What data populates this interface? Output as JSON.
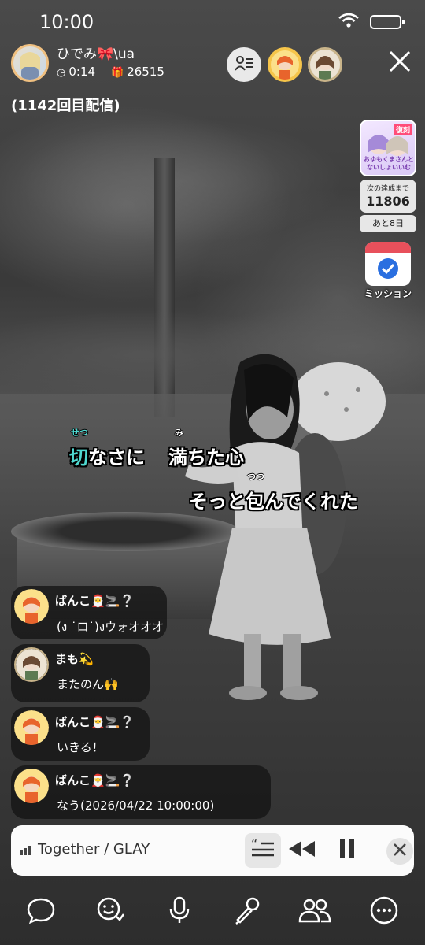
{
  "status_bar": {
    "time": "10:00"
  },
  "header": {
    "host_name": "ひでみ🎀\\ua",
    "elapsed": "0:14",
    "gifts": "26515",
    "stream_title": "(1142回目配信)"
  },
  "side": {
    "banner_tag": "復刻",
    "banner_text": "おゆもくまさんとないしょいいむ",
    "goal_label": "次の達成まで",
    "goal_value": "11806",
    "days_left": "あと8日",
    "mission_label": "ミッション"
  },
  "lyrics": {
    "line1_sung": "切",
    "line1_rest": "なさに",
    "line1_part2": "満ちた心",
    "line1_ruby1": "せつ",
    "line1_ruby2": "み",
    "line2": "そっと包んでくれた",
    "line2_ruby": "つつ"
  },
  "chat": [
    {
      "name": "ばんこ🎅🚬❔",
      "message": "(ง ˙ロ˙)งウォオオオ"
    },
    {
      "name": "まも💫",
      "message": "またのん🙌"
    },
    {
      "name": "ばんこ🎅🚬❔",
      "message": "いきる！"
    },
    {
      "name": "ばんこ🎅🚬❔",
      "message": "なう(2026/04/22 10:00:00)"
    }
  ],
  "music": {
    "song": "Together / GLAY"
  },
  "colors": {
    "lyric_highlight": "#4fd8d0",
    "mission_red": "#e8505b",
    "mission_blue": "#2a6fe0"
  }
}
